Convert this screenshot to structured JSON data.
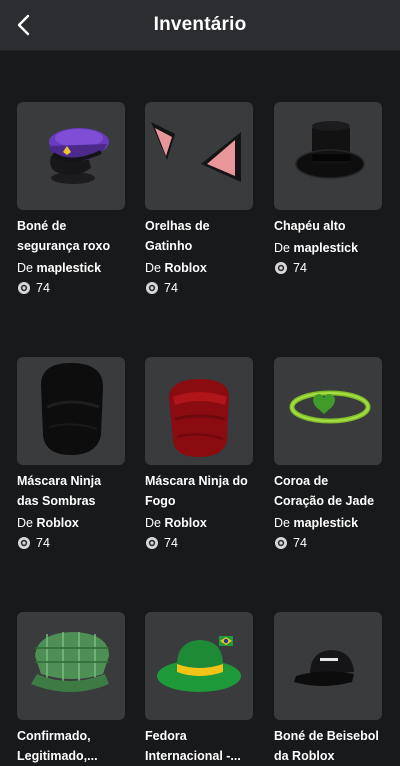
{
  "header": {
    "title": "Inventário",
    "back_icon": "chevron-left-icon"
  },
  "currency_icon": "robux-icon",
  "items": [
    {
      "name": "Boné de\nsegurança roxo",
      "by": "De",
      "creator": "maplestick",
      "price": "74",
      "icon": "purple-security-cap"
    },
    {
      "name": "Orelhas de\nGatinho",
      "by": "De",
      "creator": "Roblox",
      "price": "74",
      "icon": "kitty-ears"
    },
    {
      "name": "Chapéu alto",
      "by": "De",
      "creator": "maplestick",
      "price": "74",
      "icon": "top-hat"
    },
    {
      "name": "Máscara Ninja\ndas Sombras",
      "by": "De",
      "creator": "Roblox",
      "price": "74",
      "icon": "shadow-ninja-mask"
    },
    {
      "name": "Máscara Ninja do\nFogo",
      "by": "De",
      "creator": "Roblox",
      "price": "74",
      "icon": "fire-ninja-mask"
    },
    {
      "name": "Coroa de\nCoração de Jade",
      "by": "De",
      "creator": "maplestick",
      "price": "74",
      "icon": "jade-heart-crown"
    },
    {
      "name": "Confirmado,\nLegitimado,...",
      "icon": "green-plaid-cap"
    },
    {
      "name": "Fedora\nInternacional -...",
      "icon": "brazil-fedora"
    },
    {
      "name": "Boné de Beisebol\nda Roblox",
      "icon": "roblox-baseball-cap"
    }
  ]
}
